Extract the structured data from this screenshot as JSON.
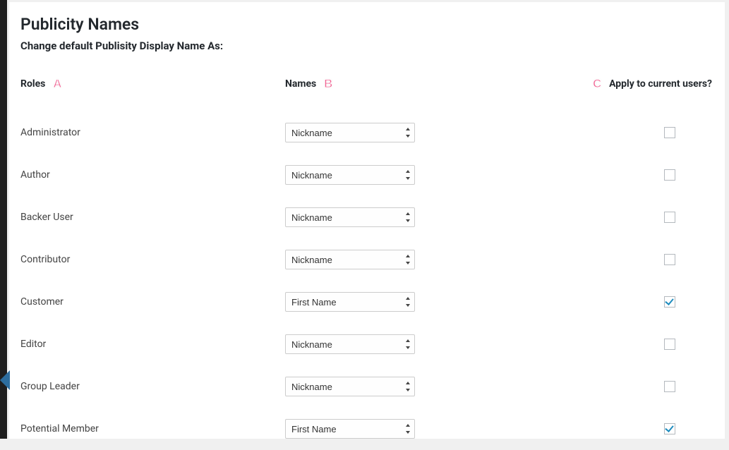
{
  "page": {
    "title": "Publicity Names",
    "subtitle": "Change default Publisity Display Name As:"
  },
  "headers": {
    "roles": "Roles",
    "names": "Names",
    "apply": "Apply to current users?"
  },
  "badges": {
    "a": "A",
    "b": "B",
    "c": "C"
  },
  "select_options": [
    "Nickname",
    "First Name"
  ],
  "rows": [
    {
      "role": "Administrator",
      "name": "Nickname",
      "apply": false
    },
    {
      "role": "Author",
      "name": "Nickname",
      "apply": false
    },
    {
      "role": "Backer User",
      "name": "Nickname",
      "apply": false
    },
    {
      "role": "Contributor",
      "name": "Nickname",
      "apply": false
    },
    {
      "role": "Customer",
      "name": "First Name",
      "apply": true
    },
    {
      "role": "Editor",
      "name": "Nickname",
      "apply": false
    },
    {
      "role": "Group Leader",
      "name": "Nickname",
      "apply": false
    },
    {
      "role": "Potential Member",
      "name": "First Name",
      "apply": true
    }
  ]
}
